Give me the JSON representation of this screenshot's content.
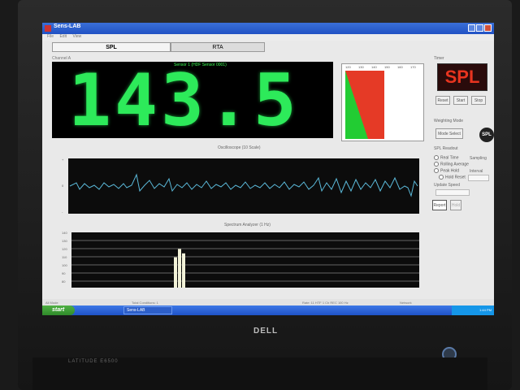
{
  "window": {
    "title": "Sens-LAB"
  },
  "menu": [
    "File",
    "Edit",
    "View"
  ],
  "tabs": [
    {
      "label": "SPL",
      "active": true
    },
    {
      "label": "RTA",
      "active": false
    }
  ],
  "channel_label": "Channel A",
  "display": {
    "sensor": "Sensor 1 (HDF Sensor 0001)",
    "reading": "143.5",
    "color": "#2dea5a"
  },
  "meter": {
    "ticks": [
      "120",
      "130",
      "140",
      "150",
      "160",
      "170"
    ],
    "red_color": "#e53a26",
    "green_color": "#22cc33"
  },
  "right_panel": {
    "timer_label": "Timer",
    "badge": "SPL",
    "buttons": [
      "Reset",
      "Start",
      "Stop"
    ],
    "weighting_label": "Weighting Mode",
    "weighting_button": "Mode Select",
    "logo": "SPL",
    "display_label": "SPL Readout",
    "options": [
      {
        "label": "Real Time",
        "value": "Sampling"
      },
      {
        "label": "Rolling Average",
        "value": ""
      },
      {
        "label": "Peak Hold",
        "value": "Interval"
      },
      {
        "label": "Hold Reset",
        "value": ""
      }
    ],
    "update_label": "Update Speed",
    "action_buttons": [
      "Report",
      "Hold"
    ]
  },
  "oscilloscope": {
    "title": "Oscilloscope (10 Scale)",
    "y_labels": [
      "+",
      "0",
      "-"
    ]
  },
  "spectrum": {
    "title": "Spectrum Analyzer (1 Hz)",
    "y_labels": [
      "140",
      "130",
      "120",
      "110",
      "100",
      "90",
      "80"
    ],
    "bars": [
      0.55,
      0.7,
      0.62
    ]
  },
  "status": {
    "left": "All Mode",
    "middle": "Total Conditions: 1",
    "right": "Rate: 11 HTF  1 Ch  REC 100 Hz",
    "far": "Network"
  },
  "taskbar": {
    "start": "start",
    "task": "Sens-LAB",
    "clock": "1:44 PM"
  },
  "laptop": {
    "brand": "LATITUDE E6500"
  }
}
